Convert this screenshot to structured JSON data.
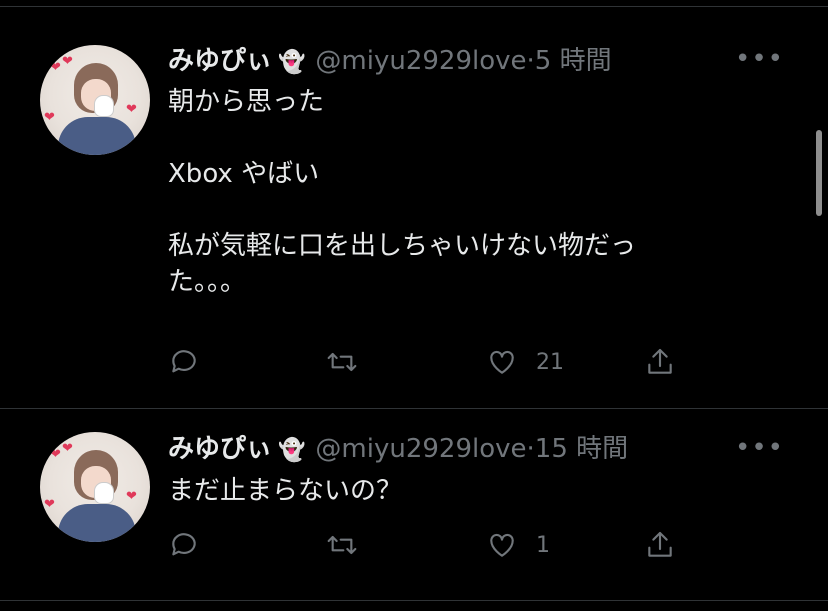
{
  "tweets": [
    {
      "name": "みゆぴぃ",
      "emoji": "👻",
      "handle": "@miyu2929love",
      "time": "5 時間",
      "text": "朝から思った\n\nXbox やばい\n\n私が気軽に口を出しちゃいけない物だっ\nた。。。",
      "likes": "21"
    },
    {
      "name": "みゆぴぃ",
      "emoji": "👻",
      "handle": "@miyu2929love",
      "time": "15 時間",
      "text": "まだ止まらないの？",
      "likes": "1"
    }
  ],
  "icons": {
    "more": "•••",
    "reply": "reply-icon",
    "retweet": "retweet-icon",
    "like": "heart-icon",
    "share": "share-icon"
  },
  "colors": {
    "background": "#000000",
    "text": "#e7e9ea",
    "secondary": "#71767b",
    "divider": "#2f3336"
  }
}
